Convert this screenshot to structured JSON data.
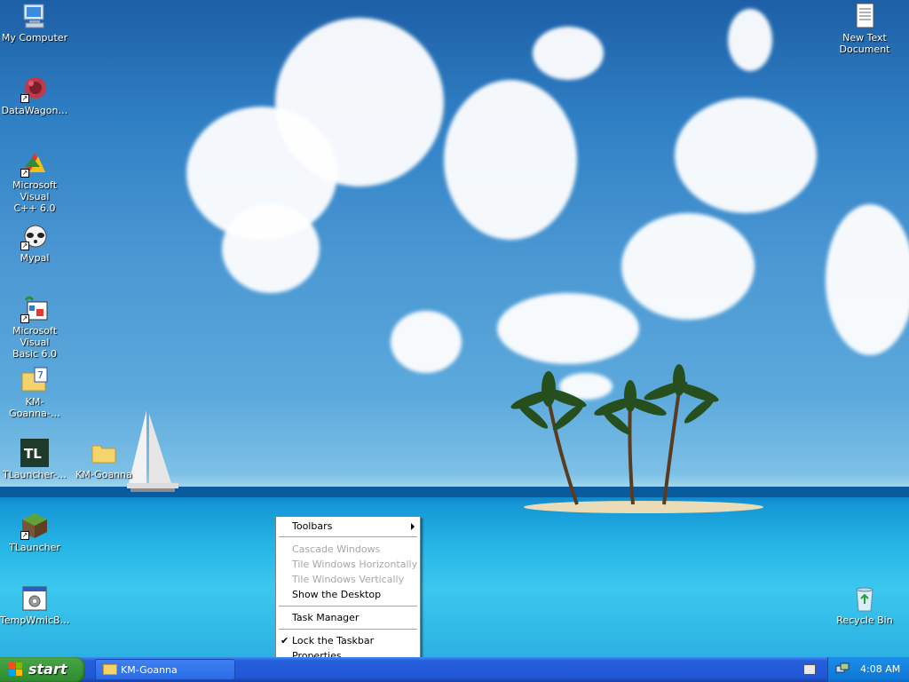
{
  "desktop": {
    "icons": [
      {
        "label": "My Computer",
        "icon": "my-computer-icon"
      },
      {
        "label": "DataWagon…",
        "icon": "datawagon-icon"
      },
      {
        "label": "Microsoft Visual\nC++ 6.0",
        "icon": "visual-cpp-icon"
      },
      {
        "label": "Mypal",
        "icon": "mypal-browser-icon"
      },
      {
        "label": "Microsoft Visual\nBasic 6.0",
        "icon": "visual-basic-icon"
      },
      {
        "label": "KM-Goanna-…",
        "icon": "archive-icon"
      },
      {
        "label": "TLauncher-…",
        "icon": "tl-icon"
      },
      {
        "label": "KM-Goanna",
        "icon": "folder-icon"
      },
      {
        "label": "TLauncher",
        "icon": "minecraft-block-icon"
      },
      {
        "label": "TempWmicB…",
        "icon": "script-icon"
      },
      {
        "label": "New Text\nDocument",
        "icon": "text-document-icon"
      },
      {
        "label": "Recycle Bin",
        "icon": "recycle-bin-icon"
      }
    ]
  },
  "context_menu": {
    "toolbars": "Toolbars",
    "cascade": "Cascade Windows",
    "tile_h": "Tile Windows Horizontally",
    "tile_v": "Tile Windows Vertically",
    "show_desktop": "Show the Desktop",
    "task_manager": "Task Manager",
    "lock": "Lock the Taskbar",
    "lock_check": "✔",
    "properties": "Properties"
  },
  "taskbar": {
    "start_label": "start",
    "task_label": "KM-Goanna",
    "clock": "4:08 AM"
  },
  "colors": {
    "taskbar_blue": "#245edb",
    "start_green": "#3c9b3c",
    "tray_blue": "#0f7ad8"
  }
}
